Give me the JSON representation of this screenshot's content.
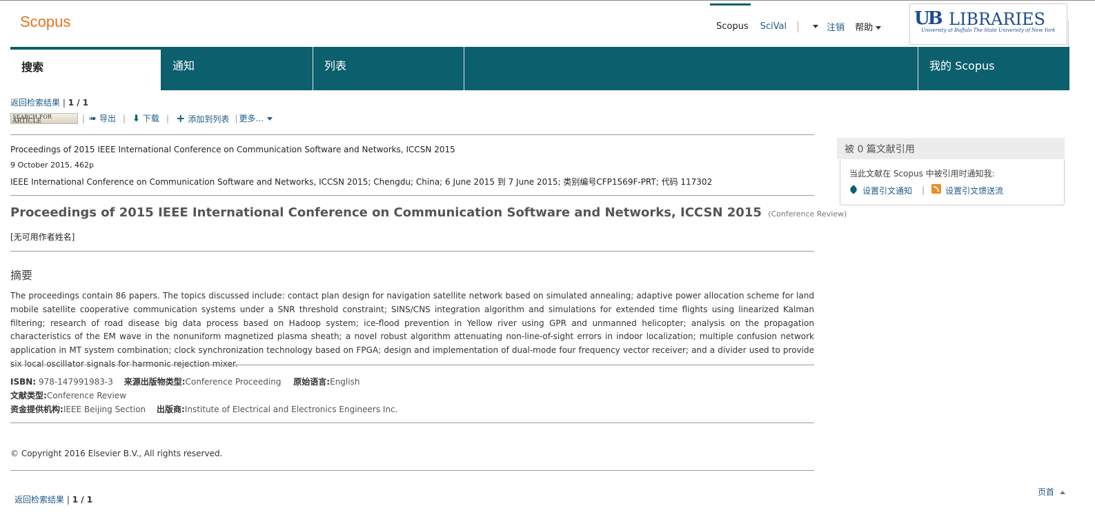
{
  "header": {
    "logo": "Scopus",
    "nav": [
      "Scopus",
      "SciVal"
    ],
    "logout": "注销",
    "help": "帮助",
    "library_logo": {
      "mark": "UB",
      "name": "LIBRARIES",
      "sub": "University at Buffalo  The State University of New York"
    }
  },
  "tabs": [
    "搜索",
    "通知",
    "列表",
    "我的 Scopus"
  ],
  "toolbar": {
    "back": "返回检索结果",
    "page": "1 / 1",
    "sfa_line1": "SEARCH FOR",
    "sfa_line2": "ARTICLE",
    "export": "导出",
    "download": "下载",
    "add_to_list": "添加到列表",
    "more": "更多..."
  },
  "source": {
    "line1": "Proceedings of 2015 IEEE International Conference on Communication Software and Networks, ICCSN 2015",
    "line2": "9 October 2015, 462p",
    "line3": "IEEE International Conference on Communication Software and Networks, ICCSN 2015; Chengdu; China; 6 June 2015 到 7 June 2015; 类别编号CFP1569F-PRT; 代码 117302"
  },
  "document": {
    "title": "Proceedings of 2015 IEEE International Conference on Communication Software and Networks, ICCSN 2015",
    "type": "(Conference Review)",
    "authors": "[无可用作者姓名]"
  },
  "abstract": {
    "heading": "摘要",
    "text": "The proceedings contain 86 papers. The topics discussed include: contact plan design for navigation satellite network based on simulated annealing; adaptive power allocation scheme for land mobile satellite cooperative communication systems under a SNR threshold constraint; SINS/CNS integration algorithm and simulations for extended time flights using linearized Kalman filtering; research of road disease big data process based on Hadoop system; ice-flood prevention in Yellow river using GPR and unmanned helicopter; analysis on the propagation characteristics of the EM wave in the nonuniform magnetized plasma sheath; a novel robust algorithm attenuating non-line-of-sight errors in indoor localization; multiple confusion network application in MT system combination; clock synchronization technology based on FPGA; design and implementation of dual-mode four frequency vector receiver; and a divider used to provide six local oscillator signals for harmonic rejection mixer."
  },
  "info": {
    "isbn_label": "ISBN:",
    "isbn": "978-147991983-3",
    "source_type_label": "来源出版物类型:",
    "source_type": "Conference Proceeding",
    "language_label": "原始语言:",
    "language": "English",
    "doc_type_label": "文献类型:",
    "doc_type": "Conference Review",
    "sponsor_label": "资金提供机构:",
    "sponsor": "IEEE Beijing Section",
    "publisher_label": "出版商:",
    "publisher": "Institute of Electrical and Electronics Engineers Inc."
  },
  "copyright": "© Copyright 2016 Elsevier B.V., All rights reserved.",
  "footer": {
    "back": "返回检索结果",
    "page": "1 / 1",
    "page_top": "页首"
  },
  "sidebar": {
    "cited_heading": "被 0 篇文献引用",
    "notify_text": "当此文献在 Scopus 中被引用时通知我:",
    "set_alert": "设置引文通知",
    "set_feed": "设置引文馈送流"
  },
  "colors": {
    "brand": "#e9711c",
    "nav": "#0c5f6c",
    "link": "#1f5a8a"
  }
}
